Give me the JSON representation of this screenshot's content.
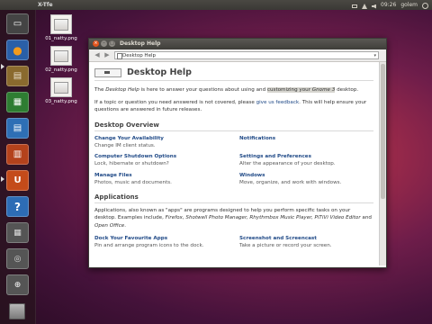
{
  "top_panel": {
    "app_title": "X-Tfe",
    "clock": "09:26",
    "user": "golem"
  },
  "launcher": {
    "items": [
      {
        "name": "workspace-icon",
        "glyph": "▭"
      },
      {
        "name": "firefox-icon",
        "glyph": "◉"
      },
      {
        "name": "files-icon",
        "glyph": "▤"
      },
      {
        "name": "calc-icon",
        "glyph": "▦"
      },
      {
        "name": "writer-icon",
        "glyph": "▤"
      },
      {
        "name": "impress-icon",
        "glyph": "▥"
      },
      {
        "name": "bag-icon",
        "glyph": "▣"
      },
      {
        "name": "ubuntu-one-icon",
        "glyph": "U"
      },
      {
        "name": "help-icon",
        "glyph": "?"
      },
      {
        "name": "workspaces-icon",
        "glyph": "▦"
      },
      {
        "name": "screenshot-icon",
        "glyph": "◎"
      },
      {
        "name": "zoom-icon",
        "glyph": "⊕"
      }
    ]
  },
  "desktop_files": [
    "01_natty.png",
    "02_natty.png",
    "03_natty.png"
  ],
  "window": {
    "title": "Desktop Help",
    "location": "Desktop Help",
    "page_title": "Desktop Help",
    "intro_pre": "The ",
    "intro_em": "Desktop Help",
    "intro_mid": " is here to answer your questions about using and ",
    "intro_hl": "customizing your ",
    "intro_em2": "Gnome 3",
    "intro_post": " desktop.",
    "feedback_pre": "If a topic or question you need answered is not covered, please ",
    "feedback_link": "give us feedback",
    "feedback_post": ". This will help ensure your questions are answered in future releases.",
    "overview_heading": "Desktop Overview",
    "topics": [
      {
        "title": "Change Your Availability",
        "desc": "Change IM client status."
      },
      {
        "title": "Notifications",
        "desc": ""
      },
      {
        "title": "Computer Shutdown Options",
        "desc": "Lock, hibernate or shutdown?"
      },
      {
        "title": "Settings and Preferences",
        "desc": "Alter the appearance of your desktop."
      },
      {
        "title": "Manage Files",
        "desc": "Photos, music and documents."
      },
      {
        "title": "Windows",
        "desc": "Move, organize, and work with windows."
      }
    ],
    "apps_heading": "Applications",
    "apps_pre": "Applications, also known as \"apps\" are programs designed to help you perform specific tasks on your desktop. Examples include, ",
    "apps_examples": "Firefox, Shotwell Photo Manager, Rhythmbox Music Player, PiTiVi Video Editor",
    "apps_and": " and ",
    "apps_last": "Open Office",
    "apps_end": ".",
    "more_topics": [
      {
        "title": "Dock Your Favourite Apps",
        "desc": "Pin and arrange program icons to the dock."
      },
      {
        "title": "Screenshot and Screencast",
        "desc": "Take a picture or record your screen."
      }
    ]
  }
}
